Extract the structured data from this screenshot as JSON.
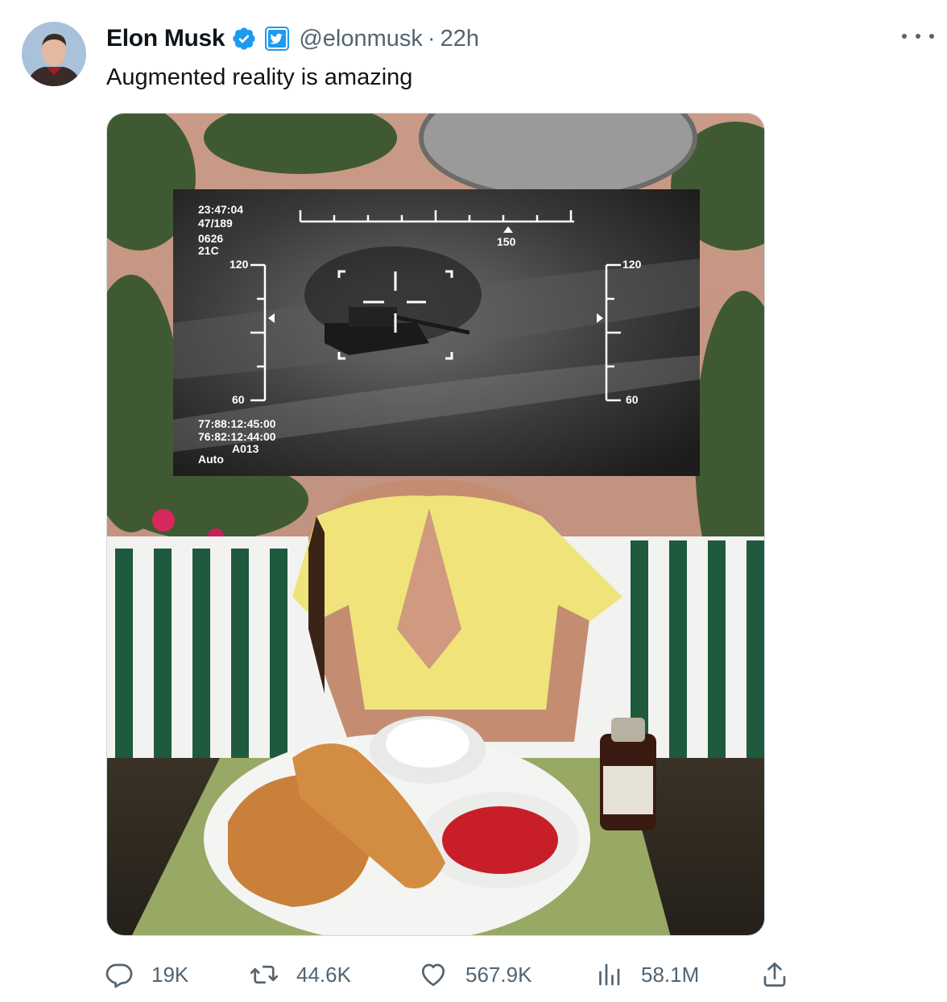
{
  "tweet": {
    "author_name": "Elon Musk",
    "handle": "@elonmusk",
    "separator": "·",
    "time": "22h",
    "text": "Augmented reality is amazing"
  },
  "hud": {
    "time": "23:47:04",
    "frame": "47/189",
    "code": "0626",
    "temp": "21C",
    "left_top": "120",
    "left_bottom": "60",
    "right_top": "120",
    "right_bottom": "60",
    "heading": "150",
    "coord1": "77:88:12:45:00",
    "coord2": "76:82:12:44:00",
    "id": "A013",
    "mode": "Auto"
  },
  "metrics": {
    "replies": "19K",
    "retweets": "44.6K",
    "likes": "567.9K",
    "views": "58.1M"
  },
  "icons": [
    "verified-badge-icon",
    "affiliate-badge-icon",
    "more-icon",
    "reply-icon",
    "retweet-icon",
    "like-icon",
    "views-icon",
    "share-icon"
  ],
  "colors": {
    "verified": "#1d9bf0",
    "secondary_text": "#536471",
    "text": "#0f1419"
  }
}
